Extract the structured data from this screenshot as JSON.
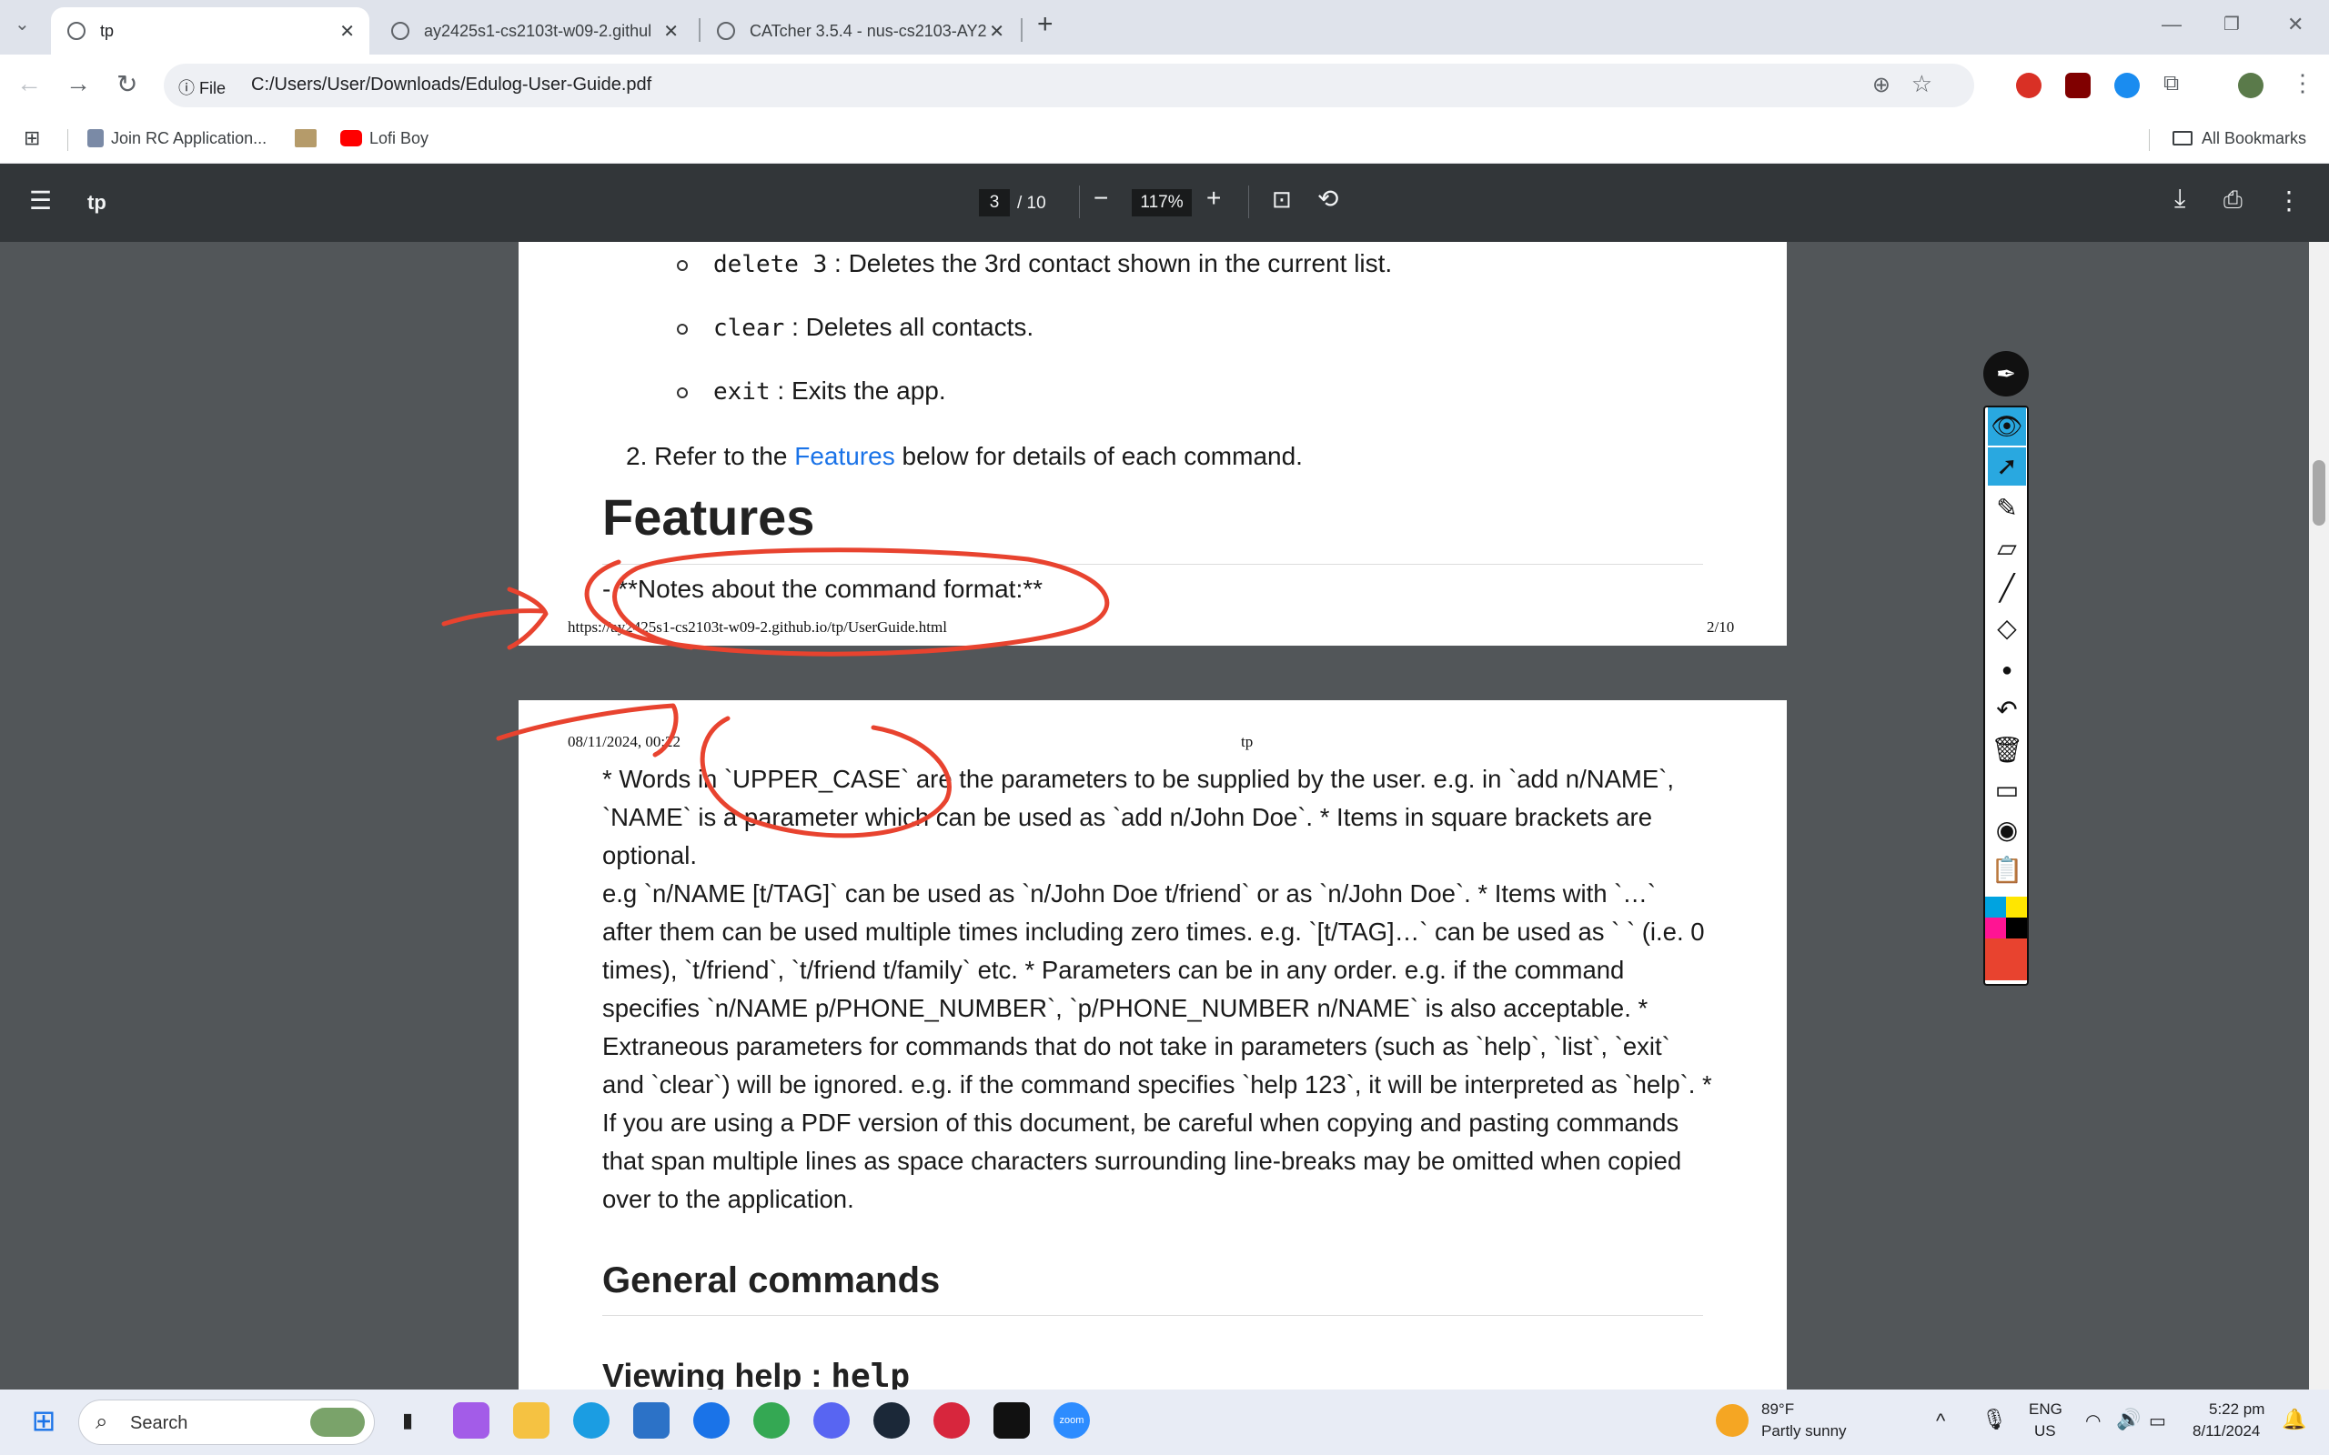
{
  "tabs": [
    {
      "title": "tp"
    },
    {
      "title": "ay2425s1-cs2103t-w09-2.githul"
    },
    {
      "title": "CATcher 3.5.4 - nus-cs2103-AY2"
    }
  ],
  "new_tab": "+",
  "address": {
    "info": "ⓘ File",
    "url": "C:/Users/User/Downloads/Edulog-User-Guide.pdf"
  },
  "bookmarks": [
    {
      "label": "Join RC Application..."
    },
    {
      "label": "Lofi Boy"
    }
  ],
  "bookmarks_all": "All Bookmarks",
  "pdf": {
    "title": "tp",
    "page_current": "3",
    "page_total": "/ 10",
    "zoom": "117%"
  },
  "page1": {
    "bullet_delete_cmd": "delete 3",
    "bullet_delete_text": ": Deletes the 3rd contact shown in the current list.",
    "bullet_clear_cmd": "clear",
    "bullet_clear_text": ": Deletes all contacts.",
    "bullet_exit_cmd": "exit",
    "bullet_exit_text": ": Exits the app.",
    "step2_prefix": "2. Refer to the ",
    "step2_link": "Features",
    "step2_suffix": " below for details of each command.",
    "heading": "Features",
    "notes": "- **Notes about the command format:**",
    "footer_url": "https://ay2425s1-cs2103t-w09-2.github.io/tp/UserGuide.html",
    "footer_page": "2/10"
  },
  "page2": {
    "header_date": "08/11/2024, 00:22",
    "header_title": "tp",
    "para1": "* Words in `UPPER_CASE` are the parameters to be supplied by the user. e.g. in `add n/NAME`, `NAME` is a parameter which can be used as `add n/John Doe`. * Items in square brackets are optional.",
    "para2": "e.g `n/NAME [t/TAG]` can be used as `n/John Doe t/friend` or as `n/John Doe`. * Items with `…` after them can be used multiple times including zero times. e.g. `[t/TAG]…` can be used as ` ` (i.e. 0 times), `t/friend`, `t/friend t/family` etc. * Parameters can be in any order. e.g. if the command specifies `n/NAME p/PHONE_NUMBER`, `p/PHONE_NUMBER n/NAME` is also acceptable. * Extraneous parameters for commands that do not take in parameters (such as `help`, `list`, `exit` and `clear`) will be ignored. e.g. if the command specifies `help 123`, it will be interpreted as `help`. * If you are using a PDF version of this document, be careful when copying and pasting commands that span multiple lines as space characters surrounding line-breaks may be omitted when copied over to the application.",
    "heading_general": "General commands",
    "heading_help": "Viewing help : ",
    "heading_help_cmd": "help"
  },
  "colors": {
    "annotation": "#e8432f",
    "palette_selected": "#29a8e0"
  },
  "taskbar": {
    "search": "Search",
    "weather_temp": "89°F",
    "weather_desc": "Partly sunny",
    "lang1": "ENG",
    "lang2": "US",
    "time": "5:22 pm",
    "date": "8/11/2024"
  }
}
